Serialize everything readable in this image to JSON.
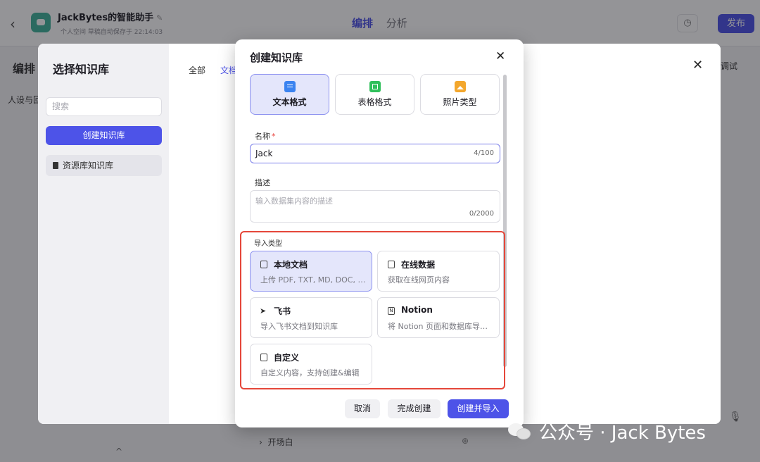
{
  "app": {
    "title": "JackBytes的智能助手",
    "title_edit_icon": "✎",
    "subtitle": "个人空间    草稿自动保存于 22:14:03",
    "back_icon": "‹"
  },
  "top_tabs": [
    "编排",
    "分析"
  ],
  "publish_label": "发布",
  "history_icon": "◷",
  "background": {
    "edit_heading": "编排",
    "persona": "人设与回",
    "debug": "调试",
    "opening": "开场白",
    "opening_chevron": "›",
    "opening_add_icon": "⊕",
    "mic_icon": "🎙",
    "collapse_icon": "^"
  },
  "select_kb": {
    "title": "选择知识库",
    "search_placeholder": "搜索",
    "create_button": "创建知识库",
    "resource_item": "资源库知识库",
    "tabs": [
      "全部",
      "文档"
    ],
    "close_icon": "✕"
  },
  "create_modal": {
    "title": "创建知识库",
    "close_icon": "✕",
    "formats": [
      {
        "label": "文本格式",
        "icon": "document-icon",
        "selected": true
      },
      {
        "label": "表格格式",
        "icon": "table-icon",
        "selected": false
      },
      {
        "label": "照片类型",
        "icon": "photo-icon",
        "selected": false
      }
    ],
    "name_label": "名称",
    "name_required_mark": "*",
    "name_value": "Jack",
    "name_counter": "4/100",
    "desc_label": "描述",
    "desc_placeholder": "输入数据集内容的描述",
    "desc_counter": "0/2000",
    "import_label": "导入类型",
    "import_types": [
      {
        "title": "本地文档",
        "desc": "上传 PDF, TXT, MD, DOC, DOCX 格式的本地文件",
        "selected": true
      },
      {
        "title": "在线数据",
        "desc": "获取在线网页内容",
        "selected": false
      },
      {
        "title": "飞书",
        "desc": "导入飞书文档到知识库",
        "selected": false
      },
      {
        "title": "Notion",
        "desc": "将 Notion 页面和数据库导入到知识库",
        "selected": false
      },
      {
        "title": "自定义",
        "desc": "自定义内容，支持创建&编辑",
        "selected": false
      }
    ],
    "feishu_glyph": "➤",
    "notion_glyph": "N",
    "buttons": {
      "cancel": "取消",
      "done": "完成创建",
      "create_import": "创建并导入"
    }
  },
  "watermark": "公众号 · Jack Bytes",
  "colors": {
    "accent": "#4d53e8",
    "highlight_border": "#e5473a",
    "selected_bg": "#e4e6fb"
  }
}
